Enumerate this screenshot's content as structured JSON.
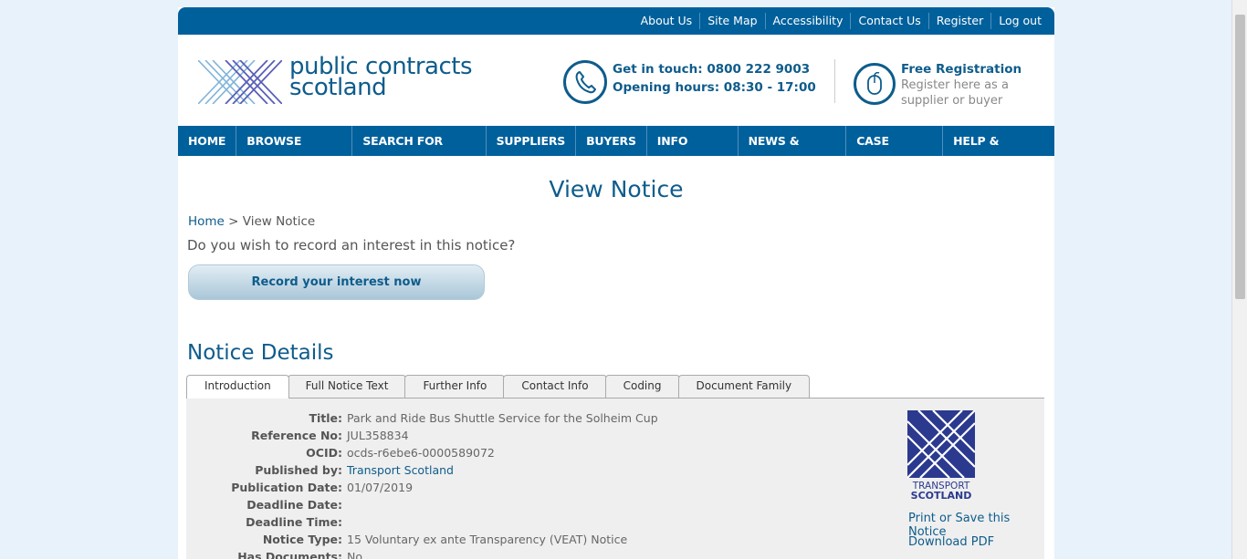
{
  "topbar": {
    "links": [
      "About Us",
      "Site Map",
      "Accessibility",
      "Contact Us",
      "Register",
      "Log out"
    ]
  },
  "header": {
    "logo_line1": "public contracts",
    "logo_line2": "scotland",
    "contact_line1": "Get in touch: 0800 222 9003",
    "contact_line2": "Opening hours: 08:30 - 17:00",
    "free_reg_title": "Free Registration",
    "free_reg_line1": "Register here as a",
    "free_reg_line2": "supplier or buyer"
  },
  "nav": {
    "items": [
      "HOME",
      "BROWSE NOTICES",
      "SEARCH FOR BUYERS",
      "SUPPLIERS",
      "BUYERS",
      "INFO CENTRE",
      "NEWS & EVENTS",
      "CASE STUDIES",
      "HELP & SUPPORT"
    ]
  },
  "main": {
    "title": "View Notice",
    "breadcrumb_home": "Home",
    "breadcrumb_sep": ">",
    "breadcrumb_current": "View Notice",
    "question": "Do you wish to record an interest in this notice?",
    "record_button": "Record your interest now",
    "section_title": "Notice Details",
    "tabs": [
      "Introduction",
      "Full Notice Text",
      "Further Info",
      "Contact Info",
      "Coding",
      "Document Family"
    ]
  },
  "details": [
    {
      "label": "Title:",
      "value": "Park and Ride Bus Shuttle Service for the Solheim Cup"
    },
    {
      "label": "Reference No:",
      "value": "JUL358834"
    },
    {
      "label": "OCID:",
      "value": "ocds-r6ebe6-0000589072"
    },
    {
      "label": "Published by:",
      "value": "Transport Scotland"
    },
    {
      "label": "Publication Date:",
      "value": "01/07/2019"
    },
    {
      "label": "Deadline Date:",
      "value": ""
    },
    {
      "label": "Deadline Time:",
      "value": ""
    },
    {
      "label": "Notice Type:",
      "value": "15 Voluntary ex ante Transparency (VEAT) Notice"
    },
    {
      "label": "Has Documents:",
      "value": "No"
    }
  ],
  "sidebar": {
    "logo_line1": "TRANSPORT",
    "logo_line2": "SCOTLAND",
    "print_link": "Print or Save this Notice",
    "pdf_link": "Download PDF"
  },
  "colors": {
    "brand_blue": "#00609c",
    "text_blue": "#0e5c8c",
    "background": "#e8f2fb"
  },
  "icons": [
    "phone-icon",
    "mouse-icon",
    "pcs-logo",
    "transport-scotland-logo"
  ]
}
